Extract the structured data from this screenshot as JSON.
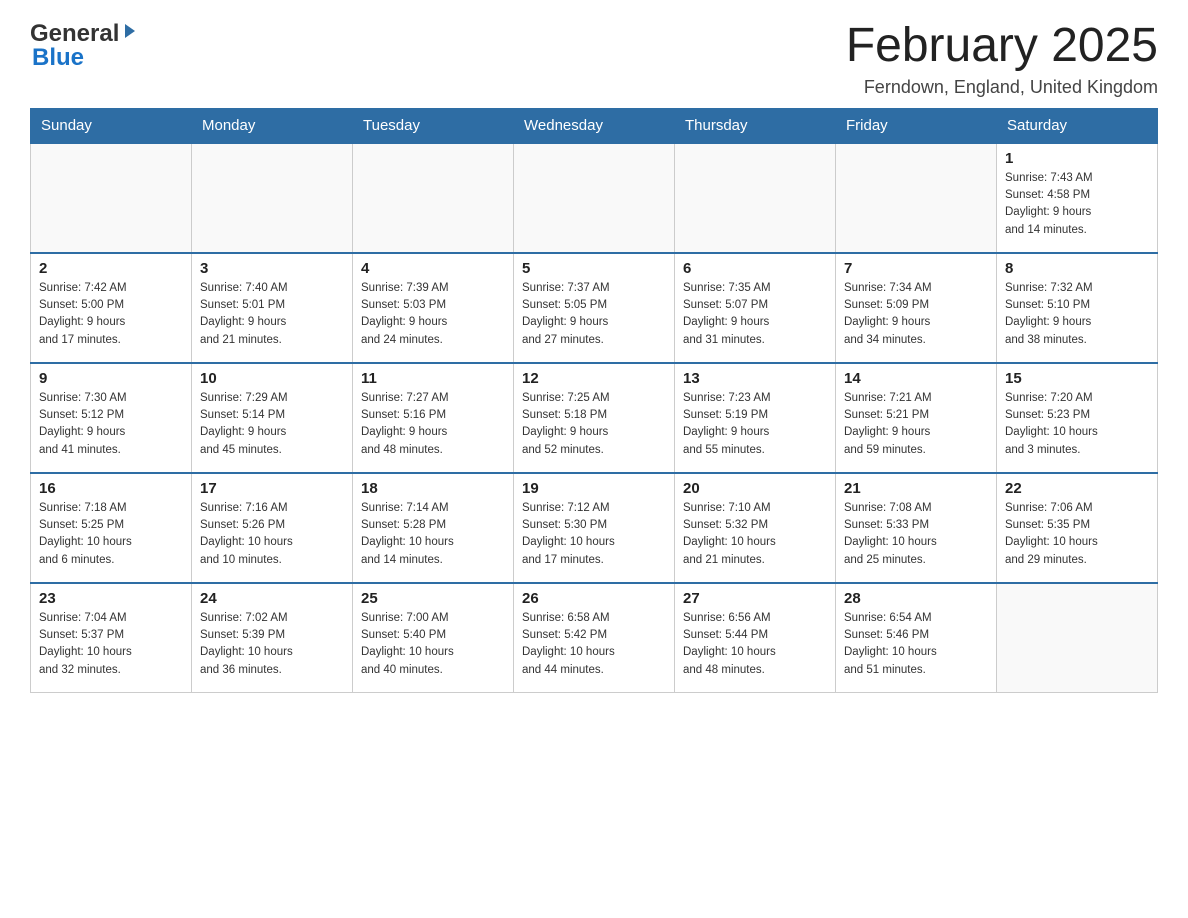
{
  "header": {
    "logo": {
      "general": "General",
      "blue": "Blue"
    },
    "title": "February 2025",
    "location": "Ferndown, England, United Kingdom"
  },
  "weekdays": [
    "Sunday",
    "Monday",
    "Tuesday",
    "Wednesday",
    "Thursday",
    "Friday",
    "Saturday"
  ],
  "weeks": [
    {
      "days": [
        {
          "date": "",
          "info": ""
        },
        {
          "date": "",
          "info": ""
        },
        {
          "date": "",
          "info": ""
        },
        {
          "date": "",
          "info": ""
        },
        {
          "date": "",
          "info": ""
        },
        {
          "date": "",
          "info": ""
        },
        {
          "date": "1",
          "info": "Sunrise: 7:43 AM\nSunset: 4:58 PM\nDaylight: 9 hours\nand 14 minutes."
        }
      ]
    },
    {
      "days": [
        {
          "date": "2",
          "info": "Sunrise: 7:42 AM\nSunset: 5:00 PM\nDaylight: 9 hours\nand 17 minutes."
        },
        {
          "date": "3",
          "info": "Sunrise: 7:40 AM\nSunset: 5:01 PM\nDaylight: 9 hours\nand 21 minutes."
        },
        {
          "date": "4",
          "info": "Sunrise: 7:39 AM\nSunset: 5:03 PM\nDaylight: 9 hours\nand 24 minutes."
        },
        {
          "date": "5",
          "info": "Sunrise: 7:37 AM\nSunset: 5:05 PM\nDaylight: 9 hours\nand 27 minutes."
        },
        {
          "date": "6",
          "info": "Sunrise: 7:35 AM\nSunset: 5:07 PM\nDaylight: 9 hours\nand 31 minutes."
        },
        {
          "date": "7",
          "info": "Sunrise: 7:34 AM\nSunset: 5:09 PM\nDaylight: 9 hours\nand 34 minutes."
        },
        {
          "date": "8",
          "info": "Sunrise: 7:32 AM\nSunset: 5:10 PM\nDaylight: 9 hours\nand 38 minutes."
        }
      ]
    },
    {
      "days": [
        {
          "date": "9",
          "info": "Sunrise: 7:30 AM\nSunset: 5:12 PM\nDaylight: 9 hours\nand 41 minutes."
        },
        {
          "date": "10",
          "info": "Sunrise: 7:29 AM\nSunset: 5:14 PM\nDaylight: 9 hours\nand 45 minutes."
        },
        {
          "date": "11",
          "info": "Sunrise: 7:27 AM\nSunset: 5:16 PM\nDaylight: 9 hours\nand 48 minutes."
        },
        {
          "date": "12",
          "info": "Sunrise: 7:25 AM\nSunset: 5:18 PM\nDaylight: 9 hours\nand 52 minutes."
        },
        {
          "date": "13",
          "info": "Sunrise: 7:23 AM\nSunset: 5:19 PM\nDaylight: 9 hours\nand 55 minutes."
        },
        {
          "date": "14",
          "info": "Sunrise: 7:21 AM\nSunset: 5:21 PM\nDaylight: 9 hours\nand 59 minutes."
        },
        {
          "date": "15",
          "info": "Sunrise: 7:20 AM\nSunset: 5:23 PM\nDaylight: 10 hours\nand 3 minutes."
        }
      ]
    },
    {
      "days": [
        {
          "date": "16",
          "info": "Sunrise: 7:18 AM\nSunset: 5:25 PM\nDaylight: 10 hours\nand 6 minutes."
        },
        {
          "date": "17",
          "info": "Sunrise: 7:16 AM\nSunset: 5:26 PM\nDaylight: 10 hours\nand 10 minutes."
        },
        {
          "date": "18",
          "info": "Sunrise: 7:14 AM\nSunset: 5:28 PM\nDaylight: 10 hours\nand 14 minutes."
        },
        {
          "date": "19",
          "info": "Sunrise: 7:12 AM\nSunset: 5:30 PM\nDaylight: 10 hours\nand 17 minutes."
        },
        {
          "date": "20",
          "info": "Sunrise: 7:10 AM\nSunset: 5:32 PM\nDaylight: 10 hours\nand 21 minutes."
        },
        {
          "date": "21",
          "info": "Sunrise: 7:08 AM\nSunset: 5:33 PM\nDaylight: 10 hours\nand 25 minutes."
        },
        {
          "date": "22",
          "info": "Sunrise: 7:06 AM\nSunset: 5:35 PM\nDaylight: 10 hours\nand 29 minutes."
        }
      ]
    },
    {
      "days": [
        {
          "date": "23",
          "info": "Sunrise: 7:04 AM\nSunset: 5:37 PM\nDaylight: 10 hours\nand 32 minutes."
        },
        {
          "date": "24",
          "info": "Sunrise: 7:02 AM\nSunset: 5:39 PM\nDaylight: 10 hours\nand 36 minutes."
        },
        {
          "date": "25",
          "info": "Sunrise: 7:00 AM\nSunset: 5:40 PM\nDaylight: 10 hours\nand 40 minutes."
        },
        {
          "date": "26",
          "info": "Sunrise: 6:58 AM\nSunset: 5:42 PM\nDaylight: 10 hours\nand 44 minutes."
        },
        {
          "date": "27",
          "info": "Sunrise: 6:56 AM\nSunset: 5:44 PM\nDaylight: 10 hours\nand 48 minutes."
        },
        {
          "date": "28",
          "info": "Sunrise: 6:54 AM\nSunset: 5:46 PM\nDaylight: 10 hours\nand 51 minutes."
        },
        {
          "date": "",
          "info": ""
        }
      ]
    }
  ],
  "colors": {
    "header_bg": "#2e6da4",
    "header_text": "#ffffff",
    "border": "#aaaaaa",
    "blue_accent": "#1a73c8"
  }
}
